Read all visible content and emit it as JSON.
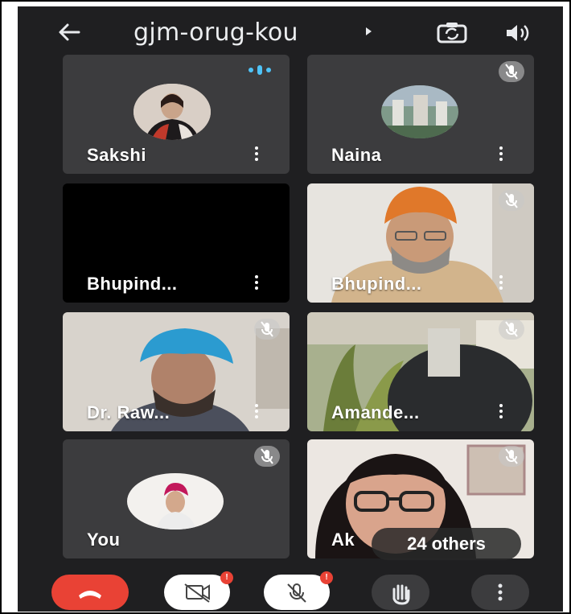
{
  "meeting": {
    "code": "gjm-orug-kou",
    "back_icon": "arrow-left-icon",
    "switch_camera_icon": "camera-switch-icon",
    "audio_icon": "speaker-icon"
  },
  "participants": [
    {
      "name": "Sakshi",
      "muted": false,
      "speaking": true,
      "view": "avatar"
    },
    {
      "name": "Naina",
      "muted": true,
      "speaking": false,
      "view": "avatar"
    },
    {
      "name": "Bhupind...",
      "muted": false,
      "speaking": false,
      "view": "camera-off"
    },
    {
      "name": "Bhupind...",
      "muted": true,
      "speaking": false,
      "view": "video"
    },
    {
      "name": "Dr. Raw...",
      "muted": true,
      "speaking": false,
      "view": "video"
    },
    {
      "name": "Amande...",
      "muted": true,
      "speaking": false,
      "view": "video"
    },
    {
      "name": "You",
      "muted": true,
      "speaking": false,
      "view": "avatar"
    },
    {
      "name": "Ak",
      "muted": true,
      "speaking": false,
      "view": "video"
    }
  ],
  "others_label": "24 others",
  "controls": {
    "end_call_icon": "phone-hangup-icon",
    "camera_icon": "camera-off-icon",
    "mic_icon": "mic-off-icon",
    "raise_hand_icon": "raise-hand-icon",
    "more_icon": "more-vert-icon",
    "badge_symbol": "!",
    "colors": {
      "end": "#e94235",
      "bg": "#1f1f21",
      "tile": "#3c3c3e"
    }
  }
}
